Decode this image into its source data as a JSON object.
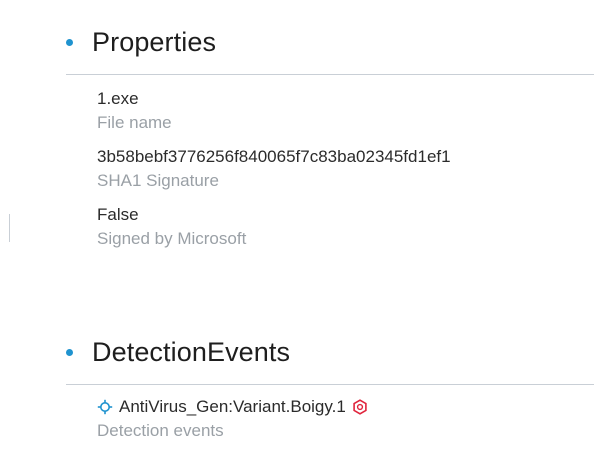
{
  "colors": {
    "accent": "#1f93cf",
    "alert": "#e0243d",
    "muted_text": "#9aa0a6",
    "rule": "#c9cfd6"
  },
  "properties": {
    "title": "Properties",
    "items": [
      {
        "value": "1.exe",
        "label": "File name"
      },
      {
        "value": "3b58bebf3776256f840065f7c83ba02345fd1ef1",
        "label": "SHA1 Signature"
      },
      {
        "value": "False",
        "label": "Signed by Microsoft"
      }
    ]
  },
  "detection_events": {
    "title": "DetectionEvents",
    "event": {
      "leading_icon": "target-icon",
      "text": "AntiVirus_Gen:Variant.Boigy.1",
      "trailing_icon": "malop-hexagon-icon"
    },
    "label": "Detection events"
  }
}
